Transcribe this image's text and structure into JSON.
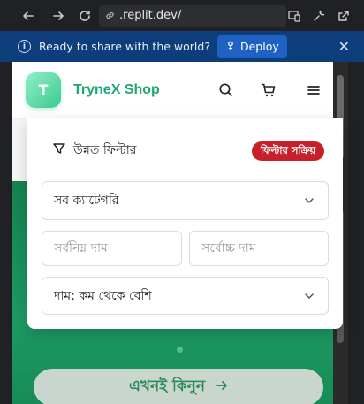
{
  "browser": {
    "url": ".replit.dev/"
  },
  "banner": {
    "message": "Ready to share with the world?",
    "deploy_label": "Deploy"
  },
  "header": {
    "logo_letter": "T",
    "brand": "TryneX Shop"
  },
  "filter": {
    "title": "উন্নত ফিল্টার",
    "badge": "ফিল্টার সক্রিয়",
    "category_value": "সব ক্যাটেগরি",
    "min_price_placeholder": "সর্বনিম্ন দাম",
    "max_price_placeholder": "সর্বোচ্চ দাম",
    "sort_value": "দাম: কম থেকে বেশি"
  },
  "hero": {
    "cta_label": "এখনই কিনুন"
  },
  "colors": {
    "brand": "#1fa872",
    "badge": "#c8202a",
    "banner": "#0d3d7a",
    "deploy": "#1f62c4"
  }
}
